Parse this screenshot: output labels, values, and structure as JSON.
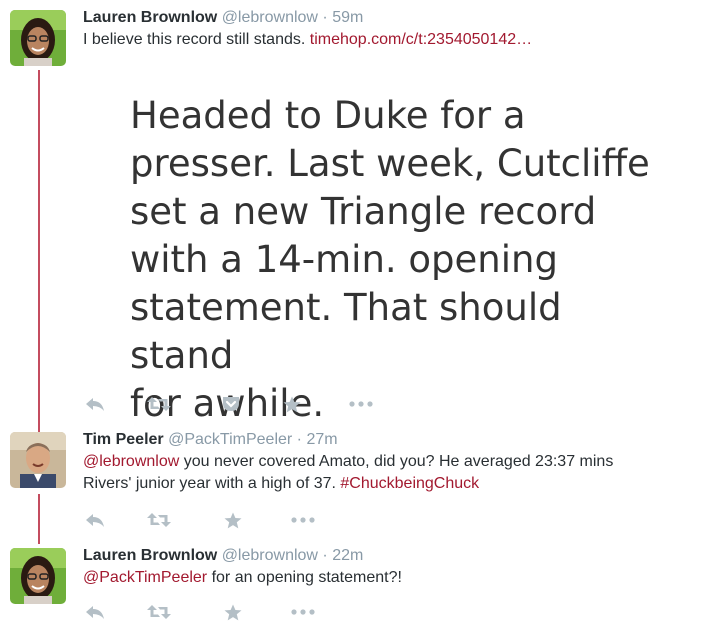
{
  "tweets": [
    {
      "name": "Lauren Brownlow",
      "handle": "@lebrownlow",
      "separator": "·",
      "time": "59m",
      "text_prefix": "I believe this record still stands. ",
      "link": "timehop.com/c/t:2354050142…",
      "media_text": "Headed to Duke for a\npresser. Last week, Cutcliffe\nset a new Triangle record\nwith a 14-min. opening\nstatement. That should stand\nfor awhile."
    },
    {
      "name": "Tim Peeler",
      "handle": "@PackTimPeeler",
      "separator": "·",
      "time": "27m",
      "mention": "@lebrownlow",
      "text_mid": " you never covered Amato, did you? He averaged 23:37 mins",
      "text_line2": "Rivers' junior year with a high of 37. ",
      "hashtag": "#ChuckbeingChuck"
    },
    {
      "name": "Lauren Brownlow",
      "handle": "@lebrownlow",
      "separator": "·",
      "time": "22m",
      "mention": "@PackTimPeeler",
      "text_rest": " for an opening statement?!"
    }
  ],
  "icons": [
    "reply-icon",
    "retweet-icon",
    "pocket-icon",
    "favorite-icon",
    "more-icon"
  ],
  "colors": {
    "link": "#a2192f",
    "thread_line": "#c44c5f",
    "icon": "#b4bfc6",
    "muted": "#8899a6"
  }
}
